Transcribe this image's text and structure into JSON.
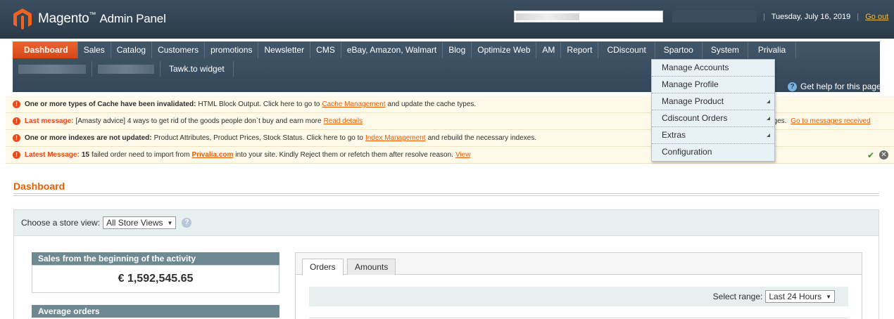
{
  "header": {
    "logo_text": "Magento",
    "logo_sub": "Admin Panel",
    "date": "Tuesday, July 16, 2019",
    "logout_label": "Go out"
  },
  "nav": {
    "items": [
      "Dashboard",
      "Sales",
      "Catalog",
      "Customers",
      "promotions",
      "Newsletter",
      "CMS",
      "eBay, Amazon, Walmart",
      "Blog",
      "Optimize Web",
      "AM",
      "Report",
      "CDiscount",
      "Spartoo",
      "System",
      "Privalia"
    ],
    "row2_item": "Tawk.to widget",
    "help_label": "Get help for this page"
  },
  "dropdown": {
    "items": [
      "Manage Accounts",
      "Manage Profile",
      "Manage Product",
      "Cdiscount Orders",
      "Extras",
      "Configuration"
    ]
  },
  "messages": [
    {
      "bold": "One or more types of Cache have been invalidated:",
      "text": "HTML Block Output. Click here to go to",
      "link": "Cache Management",
      "tail": "and update the cache types."
    },
    {
      "bold": "Last message:",
      "text": "[Amasty advice] 4 ways to get rid of the goods people don`t buy and earn more",
      "link": "Read details",
      "right_text": "ages.",
      "right_link": "Go to messages received"
    },
    {
      "bold": "One or more indexes are not updated:",
      "text": "Product Attributes, Product Prices, Stock Status. Click here to go to",
      "link": "Index Management",
      "tail": "and rebuild the necessary indexes."
    },
    {
      "bold": "Latest Message:",
      "count": "15",
      "text": "failed order need to import from",
      "link": "Privalia.com",
      "tail": "into your site. Kindly Reject them or refetch them after resolve reason.",
      "link2": "View"
    }
  ],
  "page": {
    "title": "Dashboard",
    "store_label": "Choose a store view:",
    "store_value": "All Store Views",
    "sales_header": "Sales from the beginning of the activity",
    "sales_value": "€ 1,592,545.65",
    "avg_header": "Average orders",
    "tabs": [
      "Orders",
      "Amounts"
    ],
    "range_label": "Select range:",
    "range_value": "Last 24 Hours"
  },
  "colors": {
    "accent": "#eb5e00",
    "nav_active": "#e1521e",
    "header_bg": "#2f4050"
  }
}
